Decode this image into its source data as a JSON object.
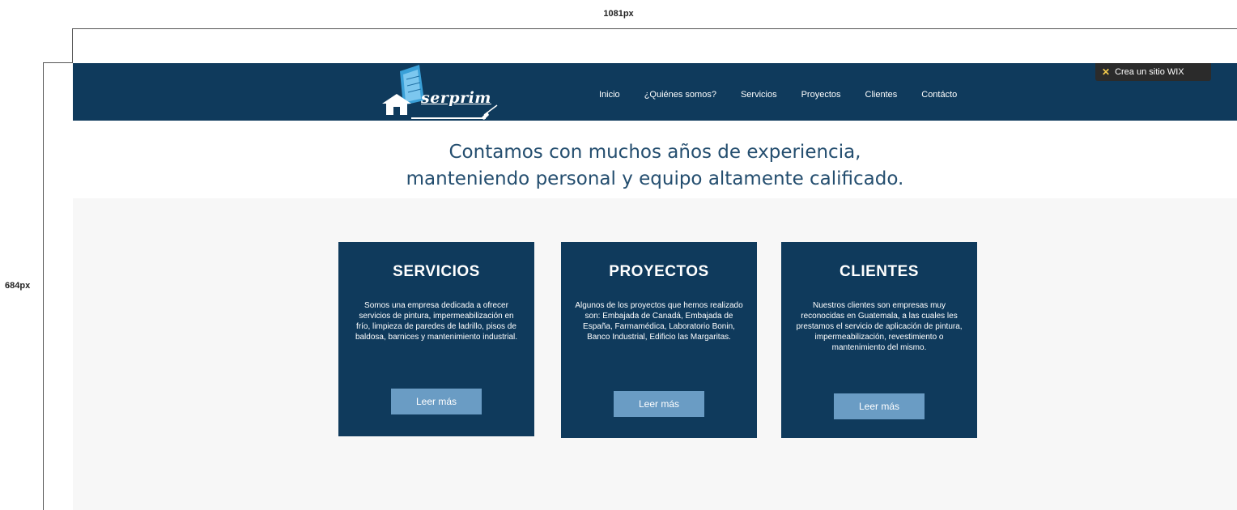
{
  "annotations": {
    "width_label": "1081px",
    "height_label": "684px"
  },
  "wix_badge": {
    "label": "Crea un sitio WIX"
  },
  "header": {
    "logo_text": "serprim",
    "nav": [
      "Inicio",
      "¿Quiénes somos?",
      "Servicios",
      "Proyectos",
      "Clientes",
      "Contácto"
    ]
  },
  "hero": {
    "line1": "Contamos con muchos años de experiencia,",
    "line2": "manteniendo personal y equipo altamente calificado."
  },
  "cards": [
    {
      "title": "SERVICIOS",
      "body": "Somos una empresa dedicada a ofrecer servicios de pintura, impermeabilización en frío, limpieza de paredes de ladrillo, pisos de baldosa, barnices y mantenimiento industrial.",
      "button": "Leer más"
    },
    {
      "title": "PROYECTOS",
      "body": "Algunos de los proyectos que hemos realizado son: Embajada de Canadá, Embajada de España, Farmamédica, Laboratorio Bonin, Banco Industrial, Edificio las Margaritas.",
      "button": "Leer más"
    },
    {
      "title": "CLIENTES",
      "body": "Nuestros clientes son empresas muy reconocidas en Guatemala, a las cuales les prestamos el servicio de aplicación de pintura, impermeabilización, revestimiento o mantenimiento del mismo.",
      "button": "Leer más"
    }
  ],
  "colors": {
    "header": "#0f3a5c",
    "card": "#0f3a5c",
    "button": "#6a9cc4",
    "hero_text": "#244e6f"
  }
}
